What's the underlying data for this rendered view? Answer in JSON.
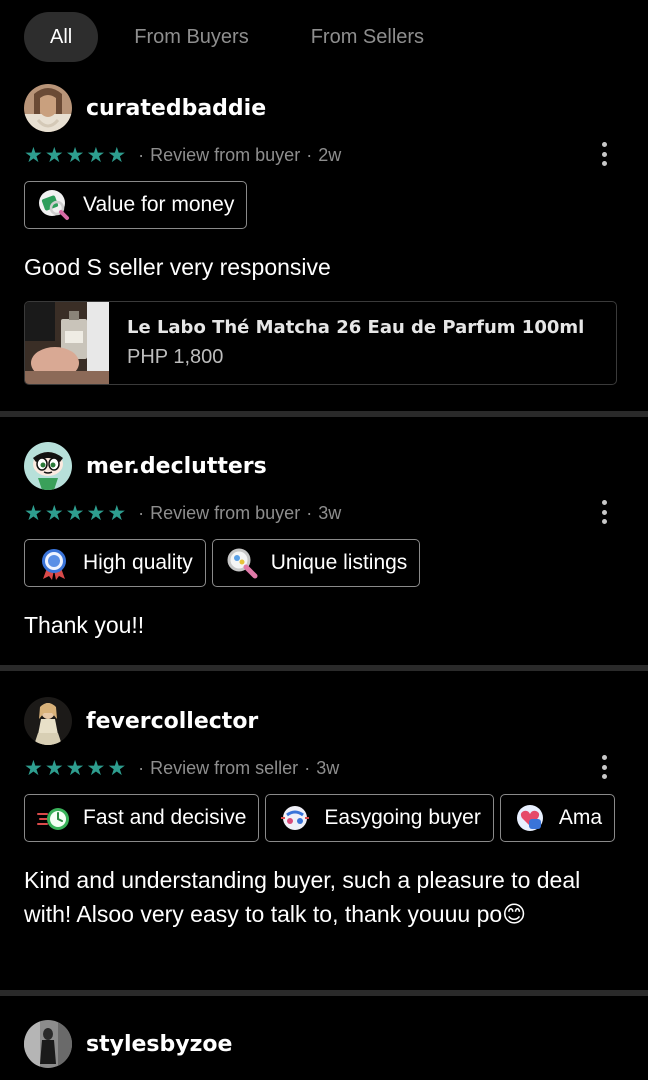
{
  "tabs": [
    {
      "label": "All",
      "active": true
    },
    {
      "label": "From Buyers",
      "active": false
    },
    {
      "label": "From Sellers",
      "active": false
    }
  ],
  "colors": {
    "star": "#2e9e8f",
    "background": "#000000",
    "divider": "#2a2a2a",
    "muted": "#8e8e8e"
  },
  "reviews": [
    {
      "username": "curatedbaddie",
      "rating": 5,
      "source": "Review from buyer",
      "separator": "·",
      "age": "2w",
      "tags": [
        {
          "label": "Value for money",
          "icon": "money-magnifier-icon"
        }
      ],
      "text": "Good S seller very responsive",
      "listing": {
        "title": "Le Labo Thé Matcha 26 Eau de Parfum 100ml",
        "price": "PHP 1,800"
      }
    },
    {
      "username": "mer.declutters",
      "rating": 5,
      "source": "Review from buyer",
      "separator": "·",
      "age": "3w",
      "tags": [
        {
          "label": "High quality",
          "icon": "rosette-award-icon"
        },
        {
          "label": "Unique listings",
          "icon": "magnifier-icon"
        }
      ],
      "text": "Thank you!!"
    },
    {
      "username": "fevercollector",
      "rating": 5,
      "source": "Review from seller",
      "separator": "·",
      "age": "3w",
      "tags": [
        {
          "label": "Fast and decisive",
          "icon": "fast-clock-icon"
        },
        {
          "label": "Easygoing buyer",
          "icon": "easygoing-icon"
        },
        {
          "label": "Ama",
          "icon": "heart-hand-icon"
        }
      ],
      "text": "Kind and understanding buyer, such a pleasure to deal with! Alsoo very easy to talk to, thank youuu po😊"
    },
    {
      "username": "stylesbyzoe"
    }
  ]
}
